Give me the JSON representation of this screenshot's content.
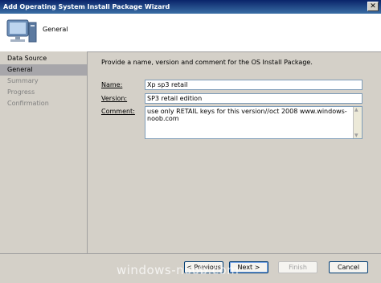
{
  "window": {
    "title": "Add Operating System Install Package Wizard",
    "close_glyph": "✕"
  },
  "header": {
    "title": "General",
    "icon": "computer-icon"
  },
  "sidebar": {
    "items": [
      {
        "label": "Data Source",
        "state": "done"
      },
      {
        "label": "General",
        "state": "active"
      },
      {
        "label": "Summary",
        "state": "pending"
      },
      {
        "label": "Progress",
        "state": "pending"
      },
      {
        "label": "Confirmation",
        "state": "pending"
      }
    ]
  },
  "main": {
    "instruction": "Provide a name, version and comment for the OS Install Package.",
    "name_label": "Name:",
    "name_value": "Xp sp3 retail",
    "version_label": "Version:",
    "version_value": "SP3 retail edition",
    "comment_label": "Comment:",
    "comment_value": "use only RETAIL keys for this version//oct 2008 www.windows-noob.com"
  },
  "footer": {
    "previous_label": "< Previous",
    "next_label": "Next >",
    "finish_label": "Finish",
    "cancel_label": "Cancel"
  },
  "watermark": "windows-noob.com"
}
